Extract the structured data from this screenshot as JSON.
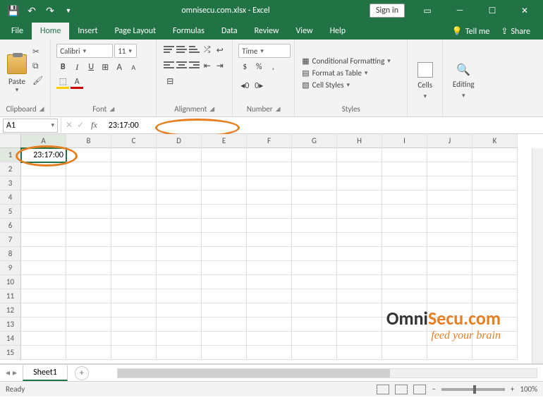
{
  "title": {
    "filename": "omnisecu.com.xlsx",
    "app": "Excel",
    "full": "omnisecu.com.xlsx  -  Excel"
  },
  "titlebar": {
    "signin": "Sign in"
  },
  "tabs": [
    "File",
    "Home",
    "Insert",
    "Page Layout",
    "Formulas",
    "Data",
    "Review",
    "View",
    "Help"
  ],
  "tellme": "Tell me",
  "share": "Share",
  "ribbon": {
    "clipboard": {
      "label": "Clipboard",
      "paste": "Paste"
    },
    "font": {
      "label": "Font",
      "name": "Calibri",
      "size": "11",
      "bold": "B",
      "italic": "I",
      "underline": "U"
    },
    "alignment": {
      "label": "Alignment"
    },
    "number": {
      "label": "Number",
      "format": "Time"
    },
    "styles": {
      "label": "Styles",
      "cond": "Conditional Formatting",
      "table": "Format as Table",
      "cell": "Cell Styles"
    },
    "cells": {
      "label": "Cells",
      "btn": "Cells"
    },
    "editing": {
      "label": "Editing",
      "btn": "Editing"
    }
  },
  "formula_bar": {
    "namebox": "A1",
    "value": "23:17:00"
  },
  "grid": {
    "columns": [
      "A",
      "B",
      "C",
      "D",
      "E",
      "F",
      "G",
      "H",
      "I",
      "J",
      "K"
    ],
    "rows": [
      "1",
      "2",
      "3",
      "4",
      "5",
      "6",
      "7",
      "8",
      "9",
      "10",
      "11",
      "12",
      "13",
      "14",
      "15"
    ],
    "active_cell": "A1",
    "a1_value": "23:17:00"
  },
  "sheet": {
    "name": "Sheet1"
  },
  "status": {
    "ready": "Ready",
    "zoom": "100%"
  },
  "watermark": {
    "brand_black": "Omni",
    "brand_orange": "Secu.com",
    "tag": "feed your brain"
  }
}
